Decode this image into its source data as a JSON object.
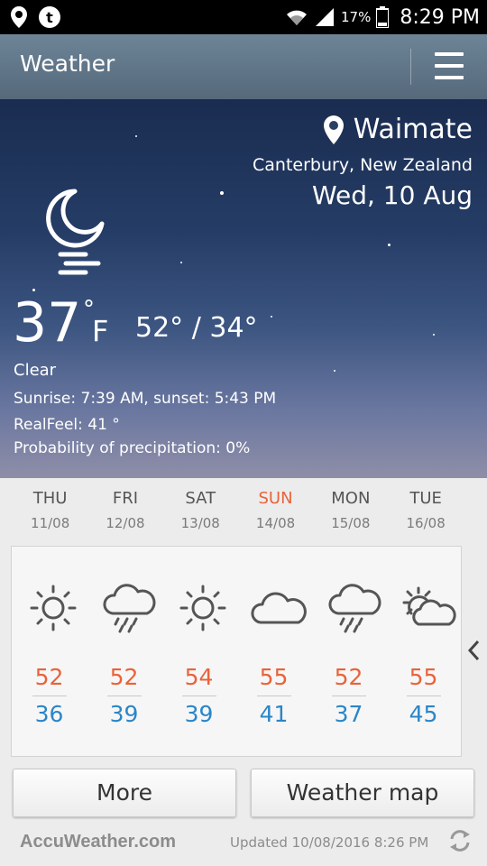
{
  "status_bar": {
    "battery": "17%",
    "time": "8:29 PM",
    "icons": [
      "location-icon",
      "t-app-icon",
      "wifi-icon",
      "signal-icon",
      "battery-icon"
    ]
  },
  "app_bar": {
    "title": "Weather",
    "menu_icon": "hamburger-icon"
  },
  "current": {
    "city": "Waimate",
    "region": "Canterbury, New Zealand",
    "date": "Wed, 10 Aug",
    "condition_icon": "moon-haze-icon",
    "temperature": "37",
    "degree": "°",
    "unit": "F",
    "hi_lo": "52° / 34°",
    "condition": "Clear",
    "sun_times": "Sunrise: 7:39  AM, sunset: 5:43  PM",
    "realfeel": "RealFeel: 41 °",
    "precipitation": "Probability of precipitation: 0%"
  },
  "forecast": {
    "days": [
      {
        "name": "THU",
        "date": "11/08",
        "icon": "sun-icon",
        "high": "52",
        "low": "36"
      },
      {
        "name": "FRI",
        "date": "12/08",
        "icon": "rain-cloud-icon",
        "high": "52",
        "low": "39"
      },
      {
        "name": "SAT",
        "date": "13/08",
        "icon": "sun-icon",
        "high": "54",
        "low": "39"
      },
      {
        "name": "SUN",
        "date": "14/08",
        "icon": "cloud-icon",
        "high": "55",
        "low": "41"
      },
      {
        "name": "MON",
        "date": "15/08",
        "icon": "rain-cloud-icon",
        "high": "52",
        "low": "37"
      },
      {
        "name": "TUE",
        "date": "16/08",
        "icon": "partly-cloudy-icon",
        "high": "55",
        "low": "45"
      }
    ],
    "nav_icon": "chevron-left-icon"
  },
  "buttons": {
    "more": "More",
    "map": "Weather map"
  },
  "footer": {
    "logo": "AccuWeather.com",
    "updated": "Updated 10/08/2016 8:26 PM",
    "refresh_icon": "refresh-icon"
  },
  "colors": {
    "high_temp": "#e8633a",
    "low_temp": "#2a86c8",
    "app_bar": "#5f7587",
    "sunday": "#e8633a"
  }
}
